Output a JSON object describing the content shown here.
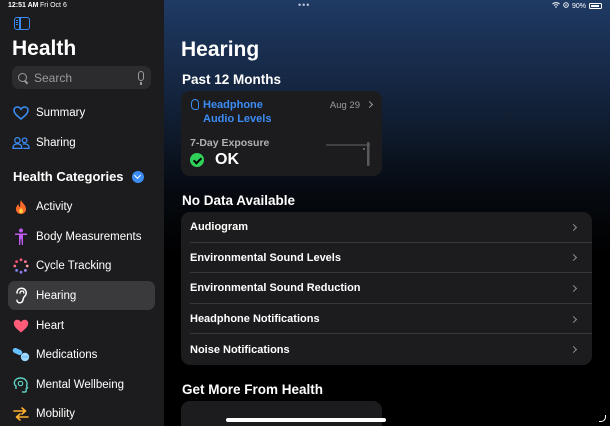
{
  "statusbar": {
    "time": "12:51 AM",
    "date": "Fri Oct 6",
    "battery": "90%",
    "multitask_dots": "•••"
  },
  "sidebar": {
    "title": "Health",
    "search_placeholder": "Search",
    "top_items": [
      {
        "label": "Summary",
        "icon": "heart-outline-icon"
      },
      {
        "label": "Sharing",
        "icon": "people-icon"
      }
    ],
    "section_title": "Health Categories",
    "categories": [
      {
        "label": "Activity",
        "icon": "flame-icon"
      },
      {
        "label": "Body Measurements",
        "icon": "body-figure-icon"
      },
      {
        "label": "Cycle Tracking",
        "icon": "cycle-dots-icon"
      },
      {
        "label": "Hearing",
        "icon": "ear-icon",
        "selected": true
      },
      {
        "label": "Heart",
        "icon": "heart-icon"
      },
      {
        "label": "Medications",
        "icon": "pills-icon"
      },
      {
        "label": "Mental Wellbeing",
        "icon": "head-icon"
      },
      {
        "label": "Mobility",
        "icon": "arrows-icon"
      }
    ]
  },
  "main": {
    "title": "Hearing",
    "past_section": "Past 12 Months",
    "card": {
      "title": "Headphone Audio Levels",
      "date": "Aug 29",
      "exposure_label": "7-Day Exposure",
      "status": "OK"
    },
    "no_data_section": "No Data Available",
    "no_data_items": [
      "Audiogram",
      "Environmental Sound Levels",
      "Environmental Sound Reduction",
      "Headphone Notifications",
      "Noise Notifications"
    ],
    "more_section": "Get More From Health"
  },
  "colors": {
    "accent": "#3b8cf5",
    "ok_green": "#30d158",
    "card_bg": "#1c1c1e",
    "sidebar_bg": "#1c1c1e"
  }
}
